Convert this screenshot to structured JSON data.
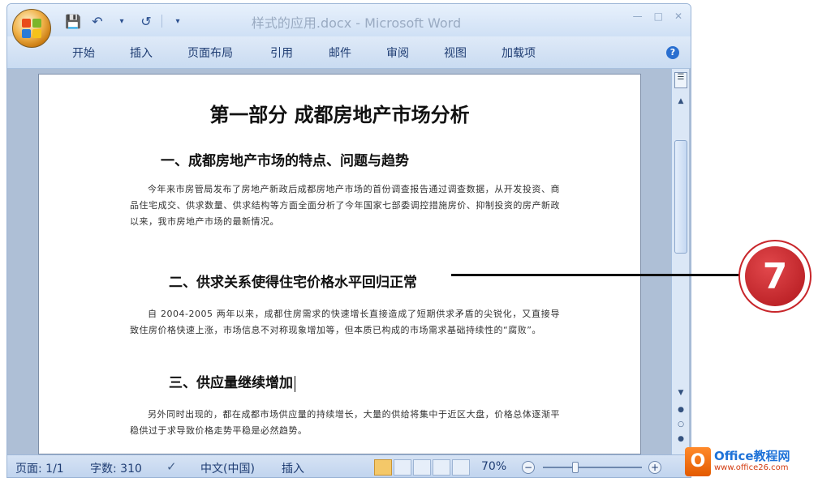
{
  "window": {
    "title": "样式的应用.docx - Microsoft Word"
  },
  "ribbon": {
    "tabs": [
      "开始",
      "插入",
      "页面布局",
      "引用",
      "邮件",
      "审阅",
      "视图",
      "加载项"
    ]
  },
  "document": {
    "title": "第一部分 成都房地产市场分析",
    "headings": [
      "一、成都房地产市场的特点、问题与趋势",
      "二、供求关系使得住宅价格水平回归正常",
      "三、供应量继续增加"
    ],
    "paragraphs": [
      "今年来市房管局发布了房地产新政后成都房地产市场的首份调查报告通过调查数据，从开发投资、商品住宅成交、供求数量、供求结构等方面全面分析了今年国家七部委调控措施房价、抑制投资的房产新政以来，我市房地产市场的最新情况。",
      "自 2004-2005 两年以来，成都住房需求的快速增长直接造成了短期供求矛盾的尖锐化，又直接导致住房价格快速上涨，市场信息不对称现象增加等，但本质已构成的市场需求基础持续性的“腐败”。",
      "另外同时出现的，都在成都市场供应量的持续增长，大量的供给将集中于近区大盘，价格总体逐渐平稳供过于求导致价格走势平稳是必然趋势。"
    ]
  },
  "statusbar": {
    "page": "页面: 1/1",
    "words": "字数: 310",
    "language": "中文(中国)",
    "mode": "插入",
    "zoom": "70%"
  },
  "callout": {
    "number": "7"
  },
  "watermark": {
    "title": "Office教程网",
    "url": "www.office26.com"
  },
  "colors": {
    "ribbon": "#dbe8f7",
    "accent": "#1f3d73",
    "callout": "#c8262b"
  }
}
